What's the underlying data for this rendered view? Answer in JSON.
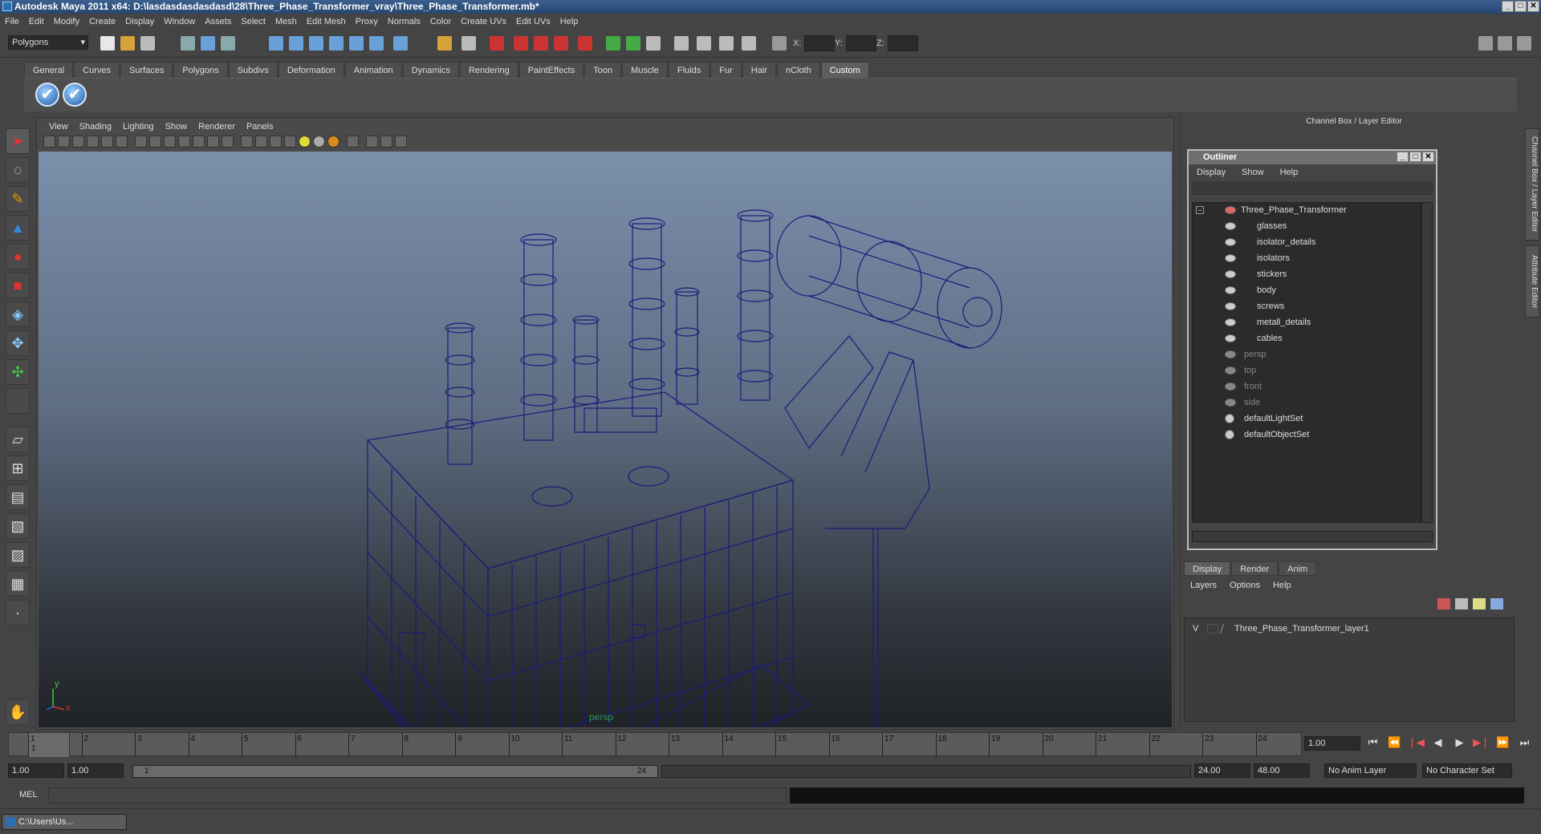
{
  "title": "Autodesk Maya 2011 x64: D:\\lasdasdasdasdasd\\28\\Three_Phase_Transformer_vray\\Three_Phase_Transformer.mb*",
  "menu": [
    "File",
    "Edit",
    "Modify",
    "Create",
    "Display",
    "Window",
    "Assets",
    "Select",
    "Mesh",
    "Edit Mesh",
    "Proxy",
    "Normals",
    "Color",
    "Create UVs",
    "Edit UVs",
    "Help"
  ],
  "status": {
    "mode": "Polygons",
    "x_label": "X:",
    "y_label": "Y:",
    "z_label": "Z:"
  },
  "shelf": {
    "tabs": [
      "General",
      "Curves",
      "Surfaces",
      "Polygons",
      "Subdivs",
      "Deformation",
      "Animation",
      "Dynamics",
      "Rendering",
      "PaintEffects",
      "Toon",
      "Muscle",
      "Fluids",
      "Fur",
      "Hair",
      "nCloth",
      "Custom"
    ],
    "active": "Custom"
  },
  "viewport": {
    "menu": [
      "View",
      "Shading",
      "Lighting",
      "Show",
      "Renderer",
      "Panels"
    ],
    "camera": "persp",
    "axis_y": "y",
    "axis_x": "x",
    "wire_color": "#1a1a7a",
    "bg_top": "#7b8fab",
    "bg_bottom": "#1f2226"
  },
  "right_panel": {
    "title": "Channel Box / Layer Editor",
    "side_tab_1": "Channel Box / Layer Editor",
    "side_tab_2": "Attribute Editor"
  },
  "outliner": {
    "title": "Outliner",
    "menu": [
      "Display",
      "Show",
      "Help"
    ],
    "items": [
      {
        "label": "Three_Phase_Transformer",
        "dim": false,
        "indent": 0
      },
      {
        "label": "glasses",
        "dim": false,
        "indent": 1
      },
      {
        "label": "isolator_details",
        "dim": false,
        "indent": 1
      },
      {
        "label": "isolators",
        "dim": false,
        "indent": 1
      },
      {
        "label": "stickers",
        "dim": false,
        "indent": 1
      },
      {
        "label": "body",
        "dim": false,
        "indent": 1
      },
      {
        "label": "screws",
        "dim": false,
        "indent": 1
      },
      {
        "label": "metall_details",
        "dim": false,
        "indent": 1
      },
      {
        "label": "cables",
        "dim": false,
        "indent": 1
      },
      {
        "label": "persp",
        "dim": true,
        "indent": 0
      },
      {
        "label": "top",
        "dim": true,
        "indent": 0
      },
      {
        "label": "front",
        "dim": true,
        "indent": 0
      },
      {
        "label": "side",
        "dim": true,
        "indent": 0
      },
      {
        "label": "defaultLightSet",
        "dim": false,
        "indent": 0
      },
      {
        "label": "defaultObjectSet",
        "dim": false,
        "indent": 0
      }
    ]
  },
  "layers": {
    "tabs": [
      "Display",
      "Render",
      "Anim"
    ],
    "active": "Display",
    "menu": [
      "Layers",
      "Options",
      "Help"
    ],
    "visible_flag": "V",
    "layer_name": "Three_Phase_Transformer_layer1"
  },
  "timeline": {
    "ticks": [
      "1",
      "2",
      "3",
      "4",
      "5",
      "6",
      "7",
      "8",
      "9",
      "10",
      "11",
      "12",
      "13",
      "14",
      "15",
      "16",
      "17",
      "18",
      "19",
      "20",
      "21",
      "22",
      "23",
      "24"
    ],
    "current": "1",
    "current_frame_field": "1.00"
  },
  "range": {
    "start_time": "1.00",
    "start_range": "1.00",
    "slider_start": "1",
    "slider_end": "24",
    "end_range": "24.00",
    "end_time": "48.00",
    "anim_layer": "No Anim Layer",
    "char_set": "No Character Set"
  },
  "mel": {
    "label": "MEL"
  },
  "taskbar": {
    "item": "C:\\Users\\Us..."
  }
}
